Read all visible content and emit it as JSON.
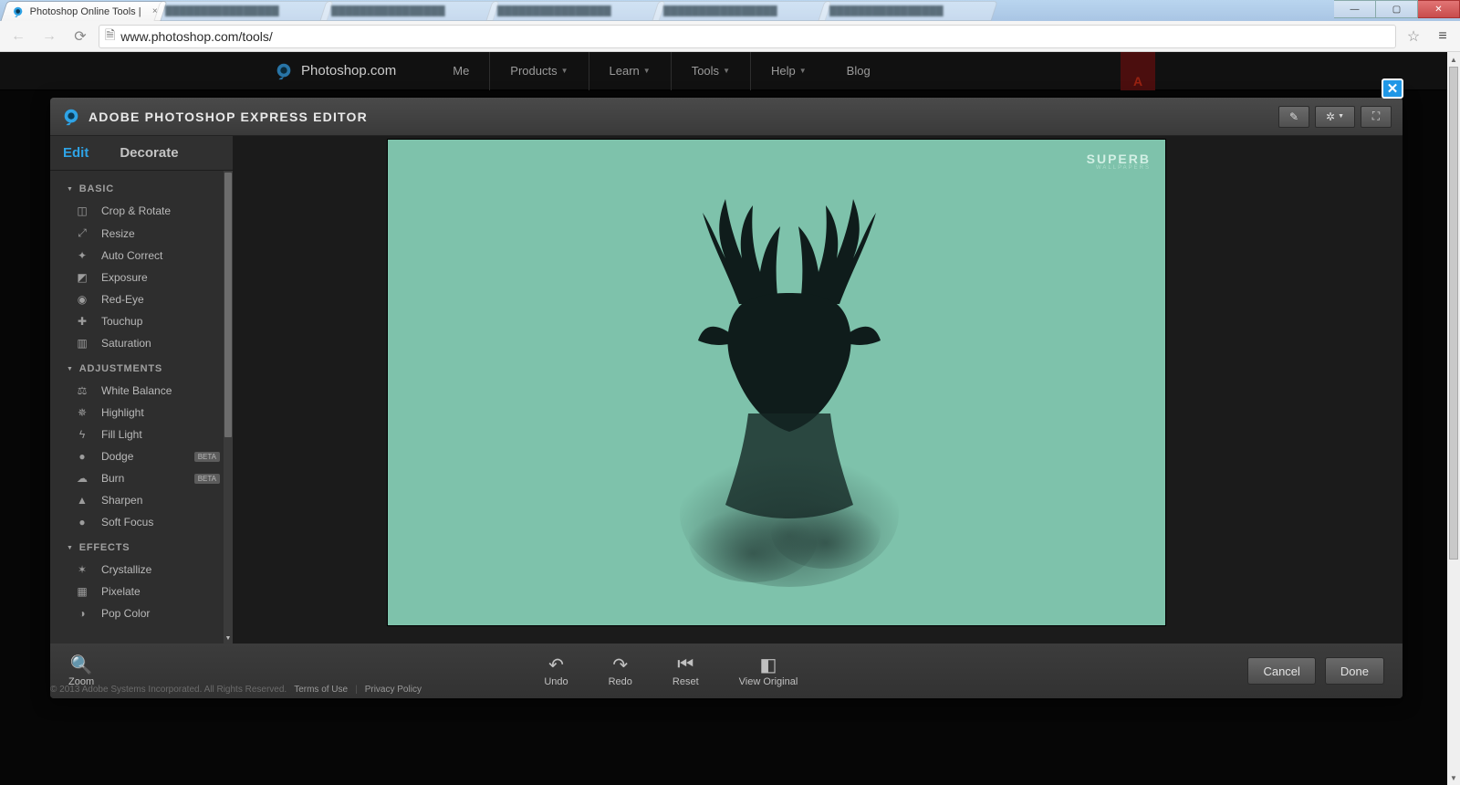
{
  "browser": {
    "active_tab_title": "Photoshop Online Tools |",
    "url": "www.photoshop.com/tools/"
  },
  "window_controls": {
    "min": "—",
    "max": "▢",
    "close": "✕"
  },
  "site_nav": {
    "brand": "Photoshop.com",
    "items": [
      "Me",
      "Products",
      "Learn",
      "Tools",
      "Help",
      "Blog"
    ],
    "adobe_glyph": "A"
  },
  "editor": {
    "title": "ADOBE PHOTOSHOP EXPRESS EDITOR",
    "close": "✕",
    "tabs": {
      "edit": "Edit",
      "decorate": "Decorate"
    },
    "sections": {
      "basic": {
        "label": "BASIC",
        "tools": [
          {
            "icon": "crop",
            "label": "Crop & Rotate"
          },
          {
            "icon": "resize",
            "label": "Resize"
          },
          {
            "icon": "wand",
            "label": "Auto Correct"
          },
          {
            "icon": "exposure",
            "label": "Exposure"
          },
          {
            "icon": "eye",
            "label": "Red-Eye"
          },
          {
            "icon": "bandaid",
            "label": "Touchup"
          },
          {
            "icon": "sat",
            "label": "Saturation"
          }
        ]
      },
      "adjustments": {
        "label": "ADJUSTMENTS",
        "tools": [
          {
            "icon": "balance",
            "label": "White Balance"
          },
          {
            "icon": "bulb",
            "label": "Highlight"
          },
          {
            "icon": "bolt",
            "label": "Fill Light"
          },
          {
            "icon": "dodge",
            "label": "Dodge",
            "badge": "BETA"
          },
          {
            "icon": "burn",
            "label": "Burn",
            "badge": "BETA"
          },
          {
            "icon": "sharpen",
            "label": "Sharpen"
          },
          {
            "icon": "drop",
            "label": "Soft Focus"
          }
        ]
      },
      "effects": {
        "label": "EFFECTS",
        "tools": [
          {
            "icon": "crystal",
            "label": "Crystallize"
          },
          {
            "icon": "pixel",
            "label": "Pixelate"
          },
          {
            "icon": "pop",
            "label": "Pop Color"
          }
        ]
      }
    },
    "bottom": {
      "zoom": "Zoom",
      "undo": "Undo",
      "redo": "Redo",
      "reset": "Reset",
      "view_original": "View Original",
      "cancel": "Cancel",
      "done": "Done"
    },
    "watermark": {
      "line1": "SUPERB",
      "line2": "WALLPAPERS"
    }
  },
  "footer": {
    "copyright": "© 2013 Adobe Systems Incorporated. All Rights Reserved.",
    "terms": "Terms of Use",
    "privacy": "Privacy Policy"
  },
  "icons": {
    "crop": "◫",
    "resize": "⤢",
    "wand": "✦",
    "exposure": "◩",
    "eye": "◉",
    "bandaid": "✚",
    "sat": "▥",
    "balance": "⚖",
    "bulb": "✵",
    "bolt": "ϟ",
    "dodge": "●",
    "burn": "☁",
    "sharpen": "▲",
    "drop": "●",
    "crystal": "✶",
    "pixel": "▦",
    "pop": "◑"
  }
}
